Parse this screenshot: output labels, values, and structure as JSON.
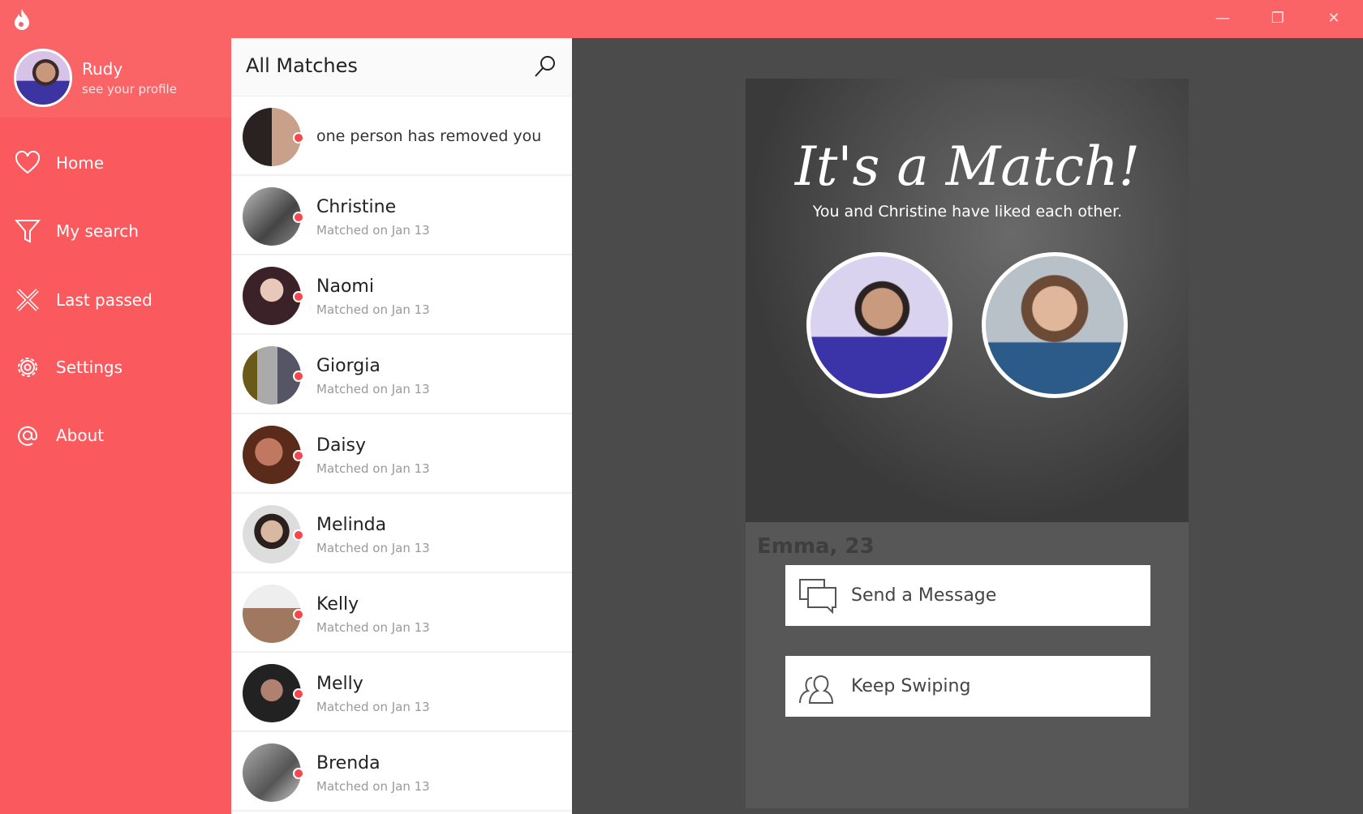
{
  "app": {
    "accent": "#fb6467",
    "logo": "flame-icon",
    "window_controls": [
      "minimize",
      "restore",
      "close"
    ]
  },
  "profile": {
    "name": "Rudy",
    "subtitle": "see your profile"
  },
  "sidebar": {
    "items": [
      {
        "label": "Home",
        "icon": "heart-icon"
      },
      {
        "label": "My search",
        "icon": "filter-icon"
      },
      {
        "label": "Last passed",
        "icon": "cross-icon"
      },
      {
        "label": "Settings",
        "icon": "gear-icon"
      },
      {
        "label": "About",
        "icon": "at-icon"
      }
    ]
  },
  "matches": {
    "title": "All Matches",
    "notice": "one person has removed you",
    "items": [
      {
        "name": "Christine",
        "date": "Matched on Jan 13"
      },
      {
        "name": "Naomi",
        "date": "Matched on Jan 13"
      },
      {
        "name": "Giorgia",
        "date": "Matched on Jan 13"
      },
      {
        "name": "Daisy",
        "date": "Matched on Jan 13"
      },
      {
        "name": "Melinda",
        "date": "Matched on Jan 13"
      },
      {
        "name": "Kelly",
        "date": "Matched on Jan 13"
      },
      {
        "name": "Melly",
        "date": "Matched on Jan 13"
      },
      {
        "name": "Brenda",
        "date": "Matched on Jan 13"
      }
    ]
  },
  "match_dialog": {
    "title": "It's a Match!",
    "subtitle": "You and Christine have liked each other.",
    "background_card_name": "Emma, 23",
    "send_label": "Send a Message",
    "keep_label": "Keep Swiping"
  }
}
